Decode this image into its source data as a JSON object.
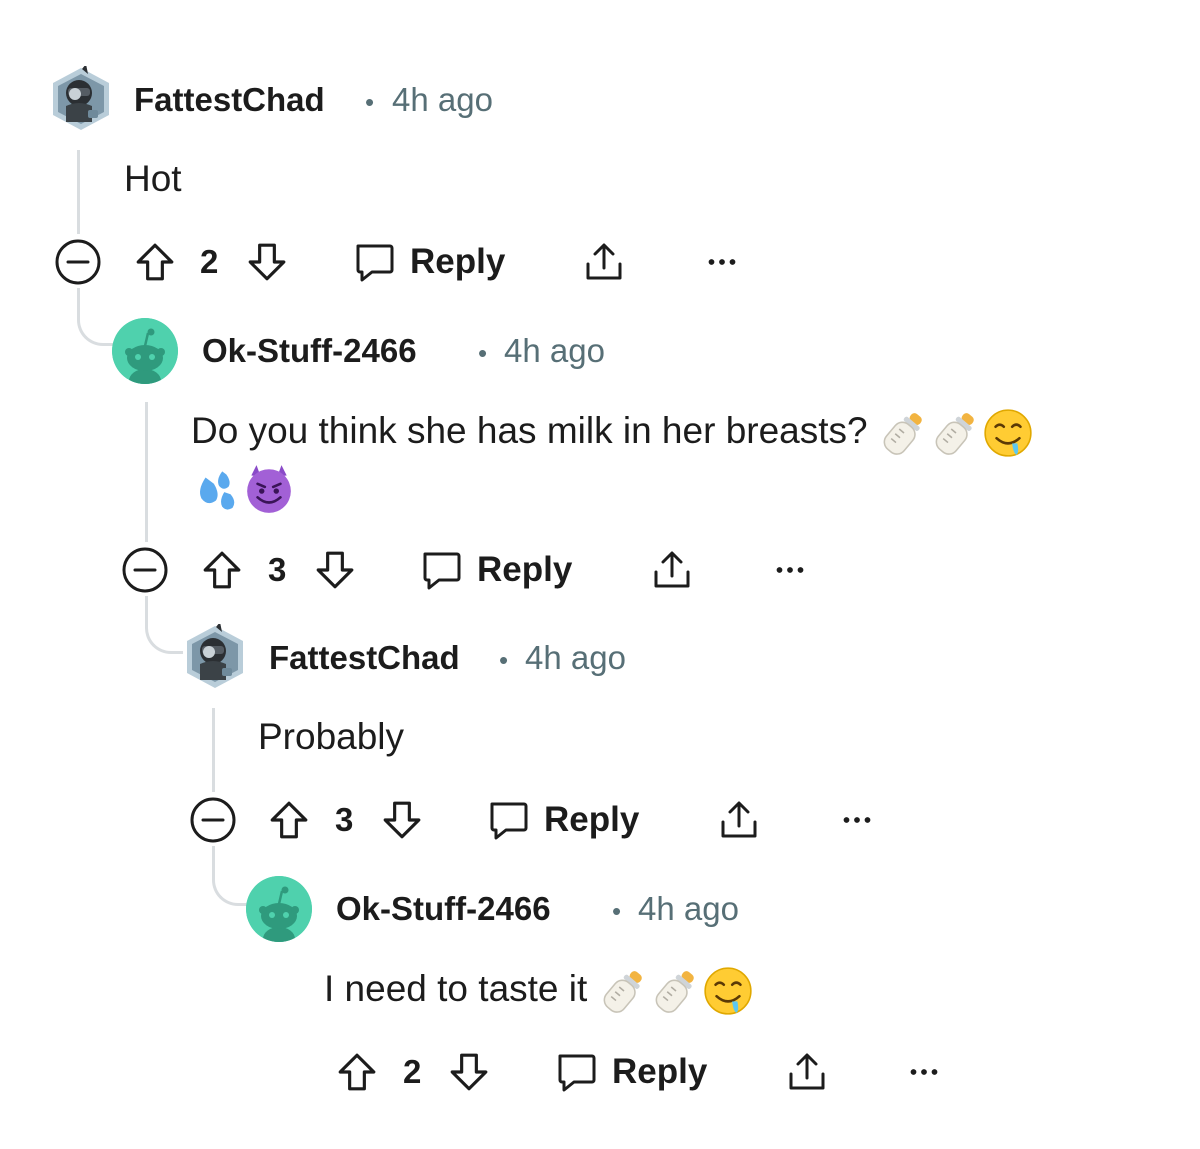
{
  "comments": [
    {
      "username": "FattestChad",
      "separator": "•",
      "time": "4h ago",
      "lines": [
        "Hot"
      ],
      "votes": "2",
      "reply_label": "Reply",
      "collapsible": true
    },
    {
      "username": "Ok-Stuff-2466",
      "separator": "•",
      "time": "4h ago",
      "lines": [
        "Do you think she has milk in her breasts?"
      ],
      "emoji_line1": [
        "baby-bottle",
        "baby-bottle",
        "drooling-face"
      ],
      "emoji_line2": [
        "sweat-droplets",
        "smiling-face-with-horns"
      ],
      "votes": "3",
      "reply_label": "Reply",
      "collapsible": true
    },
    {
      "username": "FattestChad",
      "separator": "•",
      "time": "4h ago",
      "lines": [
        "Probably"
      ],
      "votes": "3",
      "reply_label": "Reply",
      "collapsible": true
    },
    {
      "username": "Ok-Stuff-2466",
      "separator": "•",
      "time": "4h ago",
      "lines": [
        "I need to taste it"
      ],
      "emoji_line1": [
        "baby-bottle",
        "baby-bottle",
        "drooling-face"
      ],
      "votes": "2",
      "reply_label": "Reply",
      "collapsible": false
    }
  ],
  "colors": {
    "text": "#1c1c1c",
    "meta": "#576f76",
    "thread_line": "#d9dde0",
    "snoo_avatar_bg": "#4fd1ad"
  }
}
